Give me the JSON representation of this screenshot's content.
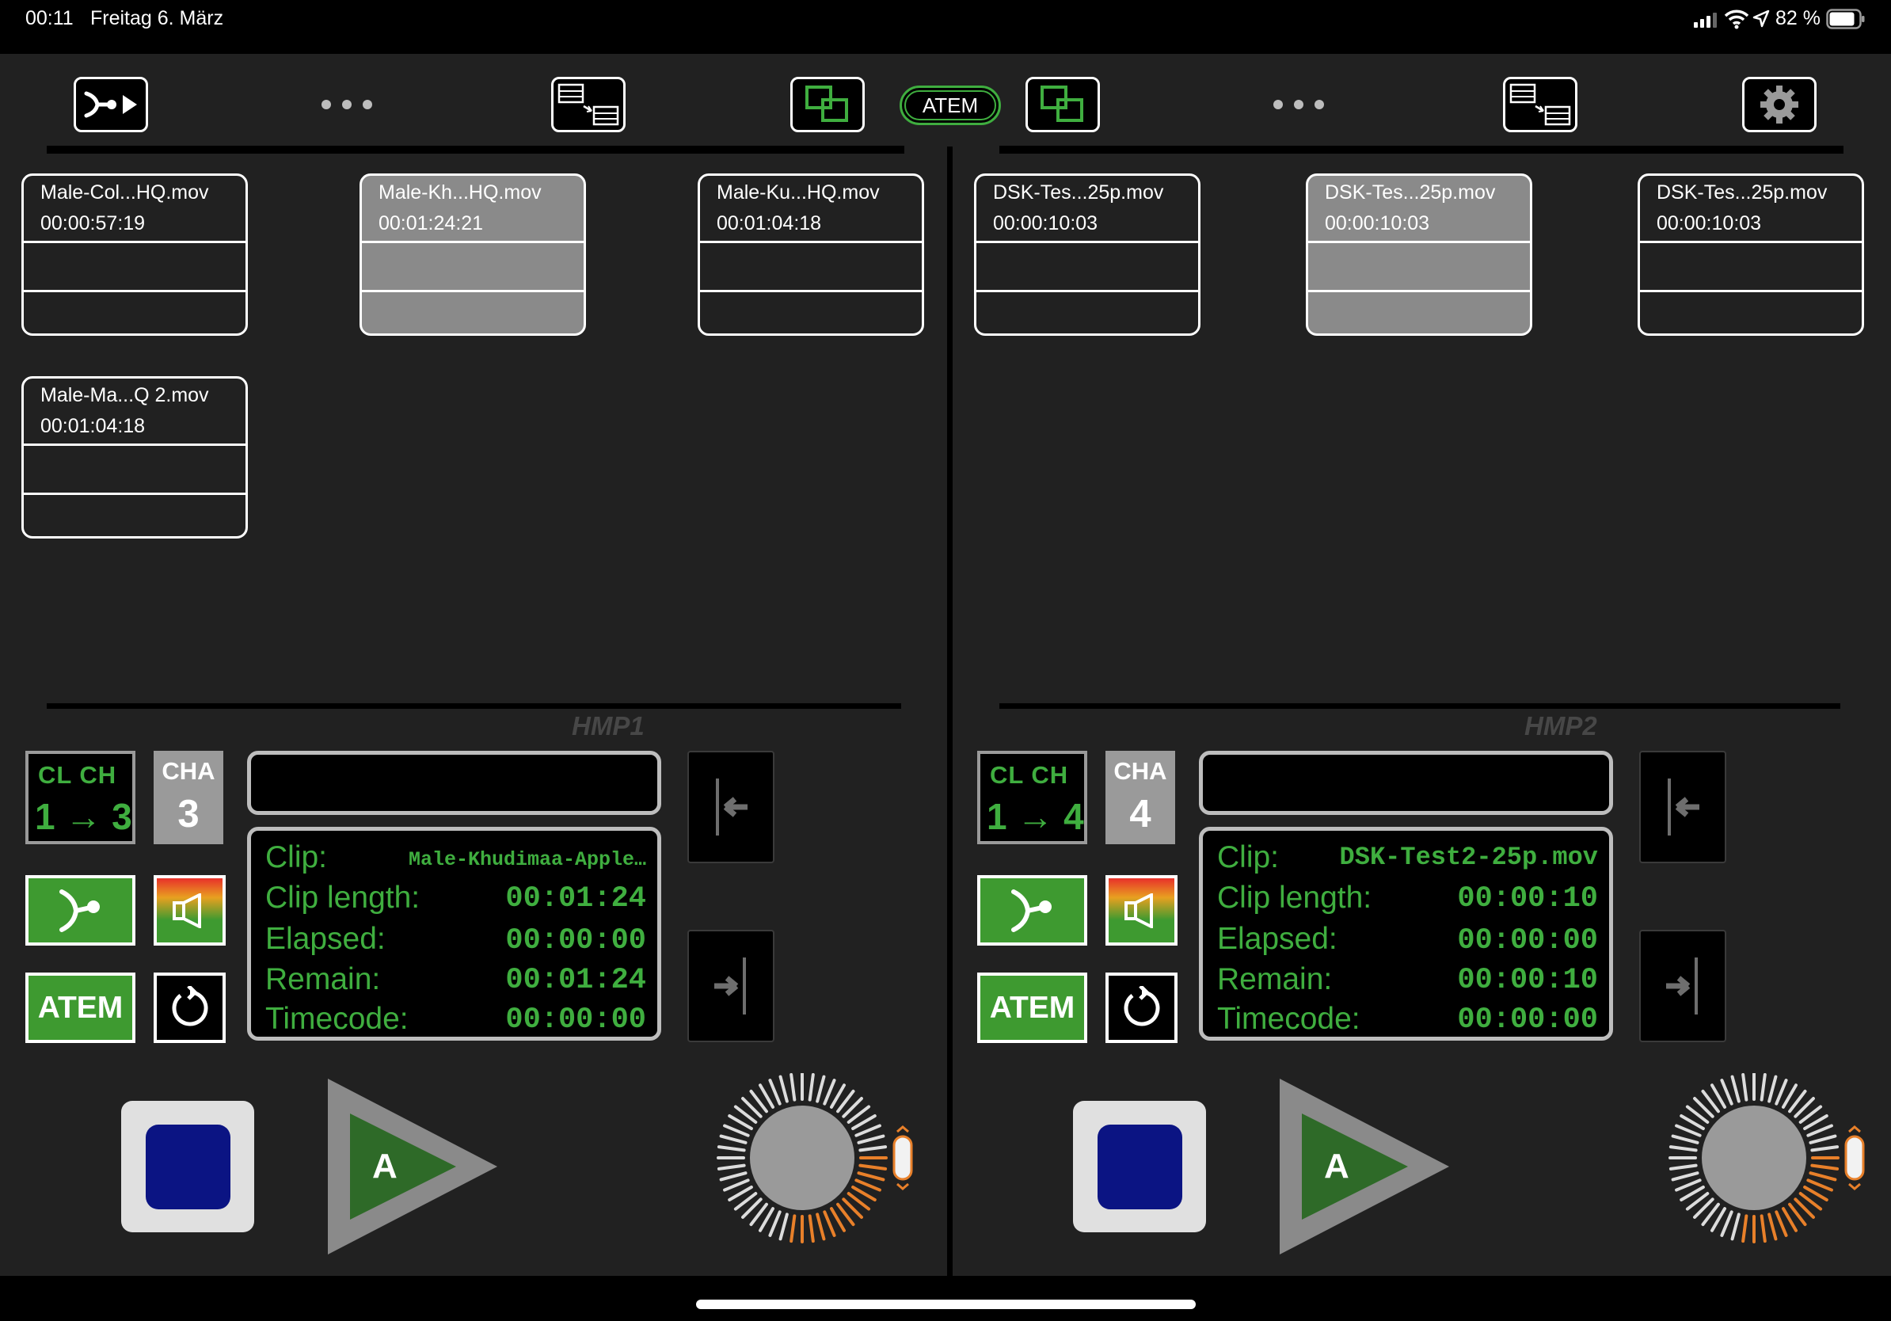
{
  "status_bar": {
    "time": "00:11",
    "date": "Freitag 6. März",
    "battery": "82 %"
  },
  "toolbar": {
    "center_label": "ATEM"
  },
  "players": [
    {
      "label": "HMP1",
      "clips": [
        {
          "name": "Male-Col...HQ.mov",
          "duration": "00:00:57:19",
          "selected": false
        },
        {
          "name": "Male-Kh...HQ.mov",
          "duration": "00:01:24:21",
          "selected": true
        },
        {
          "name": "Male-Ku...HQ.mov",
          "duration": "00:01:04:18",
          "selected": false
        },
        {
          "name": "Male-Ma...Q 2.mov",
          "duration": "00:01:04:18",
          "selected": false
        }
      ],
      "clch": {
        "top": "CL CH",
        "bottom": "1 → 3"
      },
      "cha": {
        "top": "CHA",
        "value": "3"
      },
      "info": {
        "clip_label": "Clip:",
        "clip_value": "Male-Khudimaa-Apple…",
        "length_label": "Clip length:",
        "length_value": "00:01:24",
        "elapsed_label": "Elapsed:",
        "elapsed_value": "00:00:00",
        "remain_label": "Remain:",
        "remain_value": "00:01:24",
        "timecode_label": "Timecode:",
        "timecode_value": "00:00:00"
      },
      "atem_button": "ATEM",
      "play_label": "A"
    },
    {
      "label": "HMP2",
      "clips": [
        {
          "name": "DSK-Tes...25p.mov",
          "duration": "00:00:10:03",
          "selected": false
        },
        {
          "name": "DSK-Tes...25p.mov",
          "duration": "00:00:10:03",
          "selected": true
        },
        {
          "name": "DSK-Tes...25p.mov",
          "duration": "00:00:10:03",
          "selected": false
        }
      ],
      "clch": {
        "top": "CL CH",
        "bottom": "1 → 4"
      },
      "cha": {
        "top": "CHA",
        "value": "4"
      },
      "info": {
        "clip_label": "Clip:",
        "clip_value": "DSK-Test2-25p.mov",
        "length_label": "Clip length:",
        "length_value": "00:00:10",
        "elapsed_label": "Elapsed:",
        "elapsed_value": "00:00:00",
        "remain_label": "Remain:",
        "remain_value": "00:00:10",
        "timecode_label": "Timecode:",
        "timecode_value": "00:00:00"
      },
      "atem_button": "ATEM",
      "play_label": "A"
    }
  ],
  "colors": {
    "accent_green": "#3fae3f",
    "panel_bg": "#212121",
    "stop_blue": "#0b1483",
    "jog_orange": "#e8802a"
  },
  "icons": [
    "wifi-icon",
    "location-icon",
    "battery-icon",
    "signal-icon",
    "clip-play-icon",
    "more-dots-icon",
    "swap-list-icon",
    "multiview-icon",
    "gear-icon",
    "loop-icon",
    "audio-speaker-icon",
    "rewind-to-start-icon",
    "forward-to-end-icon",
    "reload-icon",
    "stop-icon",
    "play-icon",
    "jog-wheel"
  ]
}
